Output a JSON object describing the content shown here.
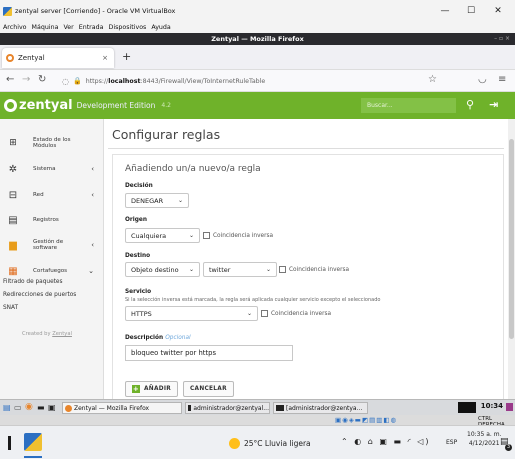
{
  "vbox": {
    "title": "zentyal server [Corriendo] - Oracle VM VirtualBox",
    "menu": [
      "Archivo",
      "Máquina",
      "Ver",
      "Entrada",
      "Dispositivos",
      "Ayuda"
    ],
    "minimize": "—",
    "maximize": "☐",
    "close": "✕"
  },
  "firefox": {
    "title": "Zentyal — Mozilla Firefox",
    "tab_label": "Zentyal",
    "tab_close": "×",
    "new_tab": "+",
    "url_prefix": "https://",
    "url_host": "localhost",
    "url_rest": ":8443/Firewall/View/ToInternetRuleTable"
  },
  "header": {
    "brand": "zentyal",
    "edition": "Development Edition",
    "version": "4.2",
    "search_placeholder": "Buscar..."
  },
  "sidebar": {
    "items": [
      {
        "label": "Estado de los Módulos"
      },
      {
        "label": "Sistema",
        "chevron": "‹"
      },
      {
        "label": "Red",
        "chevron": "‹"
      },
      {
        "label": "Registros"
      },
      {
        "label": "Gestión de software",
        "chevron": "‹"
      },
      {
        "label": "Cortafuegos",
        "chevron": "⌄"
      }
    ],
    "subitems": [
      "Filtrado de paquetes",
      "Redirecciones de puertos",
      "SNAT"
    ],
    "credit_prefix": "Created by",
    "credit_link": "Zentyal"
  },
  "main": {
    "page_title": "Configurar reglas",
    "form_title": "Añadiendo un/a nuevo/a regla",
    "decision": {
      "label": "Decisión",
      "value": "DENEGAR"
    },
    "origen": {
      "label": "Origen",
      "value": "Cualquiera",
      "checkbox": "Coincidencia inversa"
    },
    "destino": {
      "label": "Destino",
      "value": "Objeto destino",
      "value2": "twitter",
      "checkbox": "Coincidencia inversa"
    },
    "servicio": {
      "label": "Servicio",
      "help": "Si la selección inversa está marcada, la regla será aplicada cualquier servicio excepto el seleccionado",
      "value": "HTTPS",
      "checkbox": "Coincidencia inversa"
    },
    "descripcion": {
      "label": "Descripción",
      "optional": "Opcional",
      "value": "bloqueo twitter por https"
    },
    "add_button": "AÑADIR",
    "cancel_button": "CANCELAR"
  },
  "linux_taskbar": {
    "tasks": [
      "Zentyal — Mozilla Firefox",
      "administrador@zentyal...",
      "[administrador@zentya..."
    ],
    "clock": "10:34"
  },
  "vbox_status": {
    "host_key": "CTRL DERECHA"
  },
  "windows_taskbar": {
    "weather": "25°C  Lluvia ligera",
    "language": "ESP",
    "time": "10:35 a. m.",
    "date": "4/12/2021",
    "notifications": "3"
  },
  "colors": {
    "brand_green": "#6fb22a",
    "firefox_titlebar": "#2a2a2e"
  }
}
